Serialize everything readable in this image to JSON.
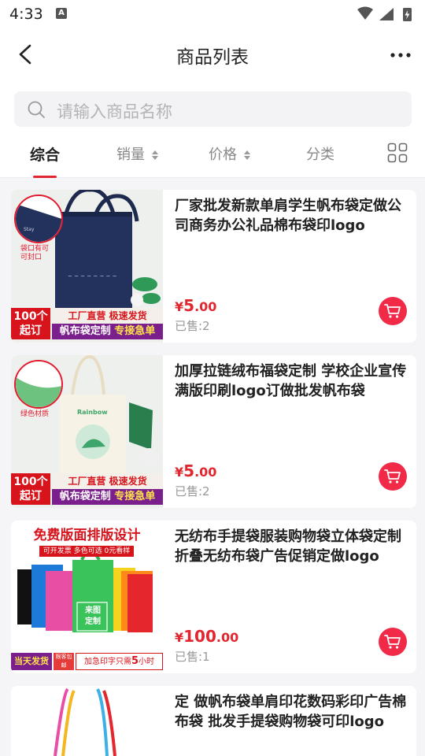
{
  "status": {
    "time": "4:33",
    "a_label": "A"
  },
  "nav": {
    "title": "商品列表"
  },
  "search": {
    "placeholder": "请输入商品名称"
  },
  "tabs": [
    {
      "label": "综合"
    },
    {
      "label": "销量"
    },
    {
      "label": "价格"
    },
    {
      "label": "分类"
    }
  ],
  "products": [
    {
      "title": "厂家批发新款单肩学生帆布袋定做公司商务办公礼品棉布袋印logo",
      "price_symbol": "¥",
      "price_int": "5",
      "price_dec": ".00",
      "sold": "已售:2",
      "image": {
        "inset_caption_1": "袋口有可",
        "inset_caption_2": "可封口",
        "tag": "100个起订",
        "tag_l1": "100个",
        "tag_l2": "起订",
        "banner_top": "工厂直营 极速发货",
        "banner_bottom_a": "帆布袋定制 ",
        "banner_bottom_b": "专接急单"
      }
    },
    {
      "title": "加厚拉链绒布福袋定制 学校企业宣传满版印刷logo订做批发帆布袋",
      "price_symbol": "¥",
      "price_int": "5",
      "price_dec": ".00",
      "sold": "已售:2",
      "image": {
        "inset_caption_1": "绿色材质",
        "bag_label": "Rainbow",
        "tag_l1": "100个",
        "tag_l2": "起订",
        "banner_top": "工厂直营 极速发货",
        "banner_bottom_a": "帆布袋定制 ",
        "banner_bottom_b": "专接急单"
      }
    },
    {
      "title": "无纺布手提袋服装购物袋立体袋定制折叠无纺布袋广告促销定做logo",
      "price_symbol": "¥",
      "price_int": "100",
      "price_dec": ".00",
      "sold": "已售:1",
      "image": {
        "promo_title": "免费版面排版设计",
        "promo_sub": "可开发票 多色可选 0元看样",
        "bag_text_1": "来图",
        "bag_text_2": "定制",
        "bottom_left": "当天发货",
        "bottom_mid": "限客包邮",
        "bottom_right_a": "加急印字只需",
        "bottom_right_b": "5",
        "bottom_right_c": "小时"
      }
    },
    {
      "title": "定 做帆布袋单肩印花数码彩印广告棉布袋 批发手提袋购物袋可印logo",
      "price_symbol": "",
      "price_int": "",
      "price_dec": "",
      "sold": ""
    }
  ],
  "colors": {
    "accent": "#e0262f",
    "cart": "#f02a47",
    "background": "#f5f5f7"
  }
}
